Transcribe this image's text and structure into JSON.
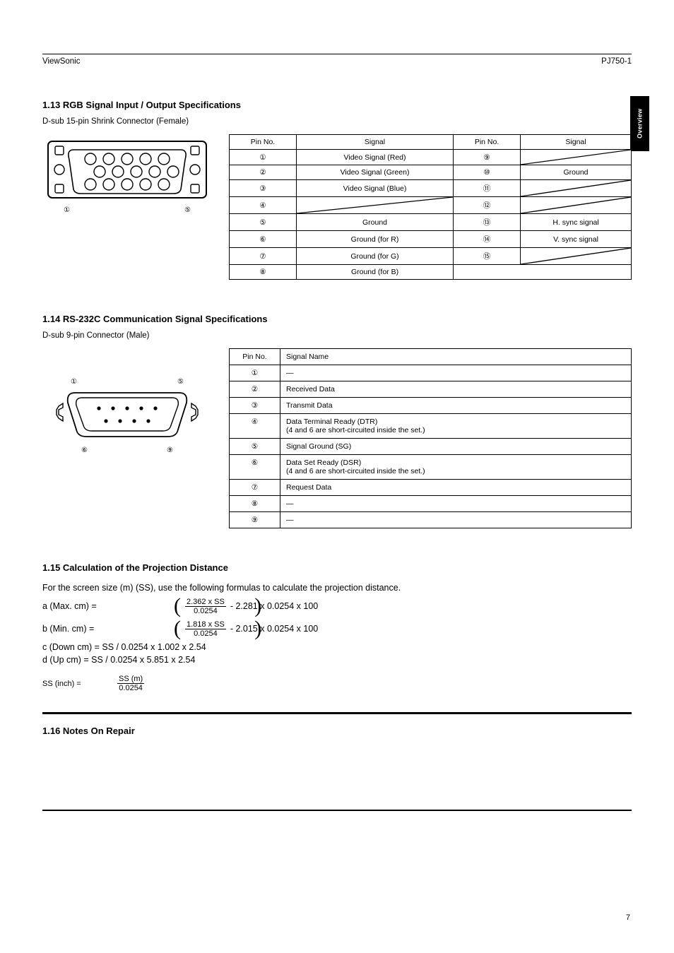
{
  "header": {
    "left": "ViewSonic",
    "right": "PJ750-1",
    "section_tab": "Overview"
  },
  "section1": {
    "title": "1.13 RGB Signal Input / Output Specifications",
    "sub": "D-sub 15-pin Shrink Connector (Female)",
    "fig_left": "①",
    "fig_right": "⑤",
    "table_head": [
      "Pin No.",
      "Signal",
      "Pin No.",
      "Signal"
    ],
    "rows": [
      [
        "①",
        "Video Signal (Red)",
        "⑨",
        "_DIAG_"
      ],
      [
        "②",
        "Video Signal (Green)",
        "⑩",
        "Ground"
      ],
      [
        "③",
        "Video Signal (Blue)",
        "⑪",
        "_DIAG_"
      ],
      [
        "④",
        "_DIAG_",
        "⑫",
        "_DIAG_"
      ],
      [
        "⑤",
        "Ground",
        "⑬",
        "H. sync signal"
      ],
      [
        "⑥",
        "Ground (for R)",
        "⑭",
        "V. sync signal"
      ],
      [
        "⑦",
        "Ground (for G)",
        "⑮",
        "_DIAG_"
      ],
      [
        "⑧",
        "Ground (for B)",
        "",
        ""
      ]
    ],
    "last_row_empty_cell": ""
  },
  "section2": {
    "title": "1.14 RS-232C Communication Signal Specifications",
    "sub": "D-sub 9-pin Connector (Male)",
    "fig_left": "①",
    "fig_right": "⑤",
    "fig_bl": "⑥",
    "fig_br": "⑨",
    "table_head": [
      "Pin No.",
      "Signal Name"
    ],
    "rows": [
      [
        "①",
        "—"
      ],
      [
        "②",
        "Received Data"
      ],
      [
        "③",
        "Transmit Data"
      ],
      [
        "④",
        "Data Terminal Ready (DTR)\n(4 and 6 are short-circuited inside the set.)"
      ],
      [
        "⑤",
        "Signal Ground (SG)"
      ],
      [
        "⑥",
        "Data Set Ready (DSR)\n(4 and 6 are short-circuited inside the set.)"
      ],
      [
        "⑦",
        "Request Data"
      ],
      [
        "⑧",
        "—"
      ],
      [
        "⑨",
        "—"
      ]
    ]
  },
  "section3": {
    "title": "1.15 Calculation of the Projection Distance",
    "intro": "For the screen size (m) (SS), use the following formulas to calculate the projection distance.",
    "eq_a_lhs": "a (Max. cm) =",
    "eq_a_num": "2.362 x SS",
    "eq_a_den": "0.0254",
    "eq_a_tail": " - 2.281  x 0.0254 x 100",
    "eq_b_lhs": "b (Min. cm)  =",
    "eq_b_num": "1.818 x SS",
    "eq_b_den": "0.0254",
    "eq_b_tail": " - 2.015  x 0.0254 x 100",
    "eq_c": "c (Down cm) = SS / 0.0254 x 1.002 x  2.54",
    "eq_d": "d (Up cm)     = SS / 0.0254 x 5.851 x  2.54",
    "inch_lhs": "SS (inch) =",
    "inch_val": "SS (m)",
    "inch_den": "0.0254"
  },
  "notes_title": "1.16 Notes On Repair",
  "page_no": "7",
  "icons": {
    "vga_connector_icon": "vga-connector",
    "db9_connector_icon": "db9-connector"
  }
}
